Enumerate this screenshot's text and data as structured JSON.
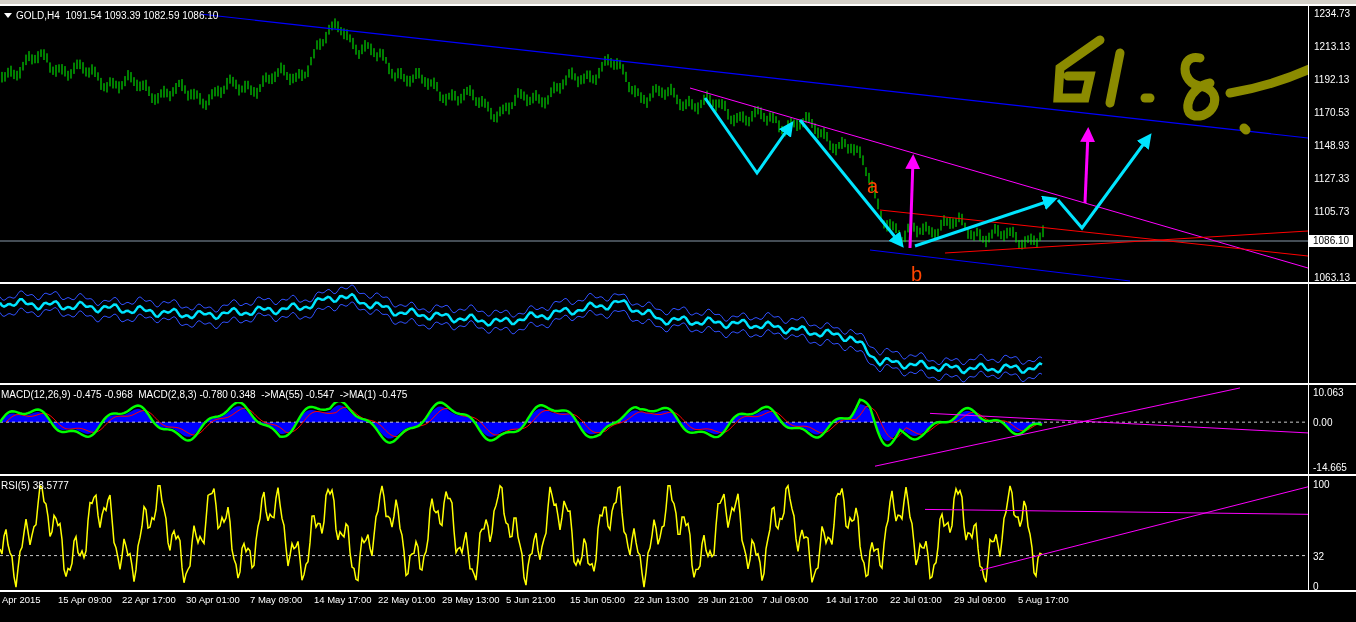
{
  "main_chart": {
    "header": "GOLD,H4  1091.54 1093.39 1082.59 1086.10",
    "price_ticks": [
      "1234.73",
      "1213.13",
      "1192.13",
      "1170.53",
      "1148.93",
      "1127.33",
      "1105.73",
      "1063.13"
    ],
    "current_price": "1086.10",
    "wave_labels": [
      {
        "text": "a"
      },
      {
        "text": "b"
      }
    ]
  },
  "macd_panel": {
    "label": "MACD(12,26,9) -0.475 -0.968  MACD(2,8,3) -0.780 0.348  ->MA(55) -0.547  ->MA(1) -0.475",
    "ticks": [
      "10.063",
      "0.00",
      "-14.665"
    ]
  },
  "rsi_panel": {
    "label": "RSI(5) 38.5777",
    "ticks": [
      "100",
      "32",
      "0"
    ]
  },
  "time_axis": [
    "Apr 2015",
    "15 Apr 09:00",
    "22 Apr 17:00",
    "30 Apr 01:00",
    "7 May 09:00",
    "14 May 17:00",
    "22 May 01:00",
    "29 May 13:00",
    "5 Jun 21:00",
    "15 Jun 05:00",
    "22 Jun 13:00",
    "29 Jun 21:00",
    "7 Jul 09:00",
    "14 Jul 17:00",
    "22 Jul 01:00",
    "29 Jul 09:00",
    "5 Aug 17:00"
  ]
}
